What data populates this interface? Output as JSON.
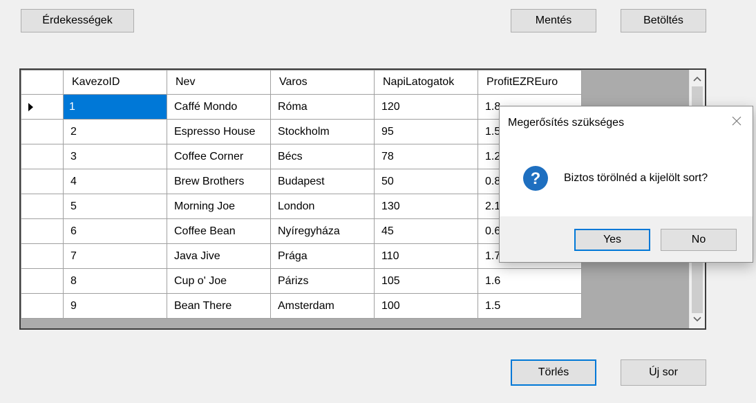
{
  "toolbar": {
    "interests_label": "Érdekességek",
    "save_label": "Mentés",
    "load_label": "Betöltés",
    "delete_label": "Törlés",
    "new_row_label": "Új sor"
  },
  "grid": {
    "columns": [
      "KavezoID",
      "Nev",
      "Varos",
      "NapiLatogatok",
      "ProfitEZREuro"
    ],
    "rows": [
      [
        "1",
        "Caffé Mondo",
        "Róma",
        "120",
        "1.8"
      ],
      [
        "2",
        "Espresso House",
        "Stockholm",
        "95",
        "1.5"
      ],
      [
        "3",
        "Coffee Corner",
        "Bécs",
        "78",
        "1.2"
      ],
      [
        "4",
        "Brew Brothers",
        "Budapest",
        "50",
        "0.8"
      ],
      [
        "5",
        "Morning Joe",
        "London",
        "130",
        "2.1"
      ],
      [
        "6",
        "Coffee Bean",
        "Nyíregyháza",
        "45",
        "0.6"
      ],
      [
        "7",
        "Java Jive",
        "Prága",
        "110",
        "1.7"
      ],
      [
        "8",
        "Cup o' Joe",
        "Párizs",
        "105",
        "1.6"
      ],
      [
        "9",
        "Bean There",
        "Amsterdam",
        "100",
        "1.5"
      ]
    ]
  },
  "dialog": {
    "title": "Megerősítés szükséges",
    "message": "Biztos törölnéd a kijelölt sort?",
    "yes_label": "Yes",
    "no_label": "No",
    "icon": "question-icon",
    "icon_color": "#1e6fc0"
  },
  "colors": {
    "selection": "#0078d7",
    "focus_border": "#0078d7"
  }
}
